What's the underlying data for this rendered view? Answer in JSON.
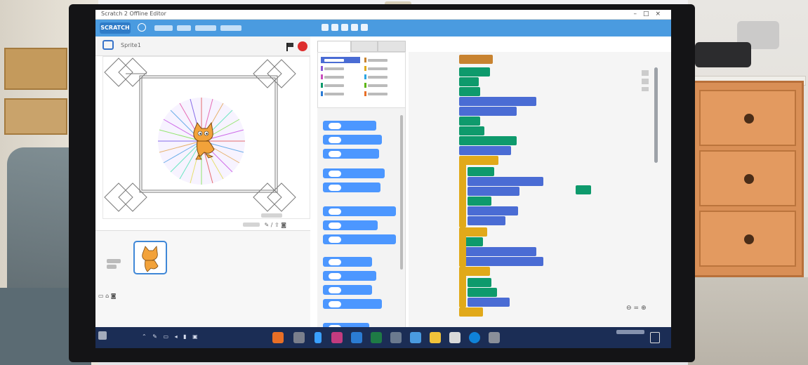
{
  "window": {
    "title": "Scratch 2 Offline Editor"
  },
  "menubar": {
    "logo": "SCRATCH"
  },
  "stage": {
    "sprite_label": "Sprite1"
  },
  "palette": {
    "tabs": [
      "",
      "",
      ""
    ],
    "categories": [
      {
        "label": "",
        "color": "#4a6cd4"
      },
      {
        "label": "",
        "color": "#8a55d7"
      },
      {
        "label": "",
        "color": "#c94fbd"
      },
      {
        "label": "",
        "color": "#0e9a6c"
      },
      {
        "label": "",
        "color": "#2a7bd6"
      },
      {
        "label": "",
        "color": "#c88330"
      },
      {
        "label": "",
        "color": "#e1a91a"
      },
      {
        "label": "",
        "color": "#2ca5e2"
      },
      {
        "label": "",
        "color": "#5cb712"
      },
      {
        "label": "",
        "color": "#e86f26"
      }
    ]
  },
  "taskbar": {
    "clock_line1": "",
    "clock_line2": ""
  },
  "colors": {
    "menubar": "#4a9be0",
    "motion": "#4a6cd4",
    "events": "#c88330",
    "control": "#e1a91a",
    "pen": "#0e9a6c",
    "taskbar": "#1b2d55"
  }
}
